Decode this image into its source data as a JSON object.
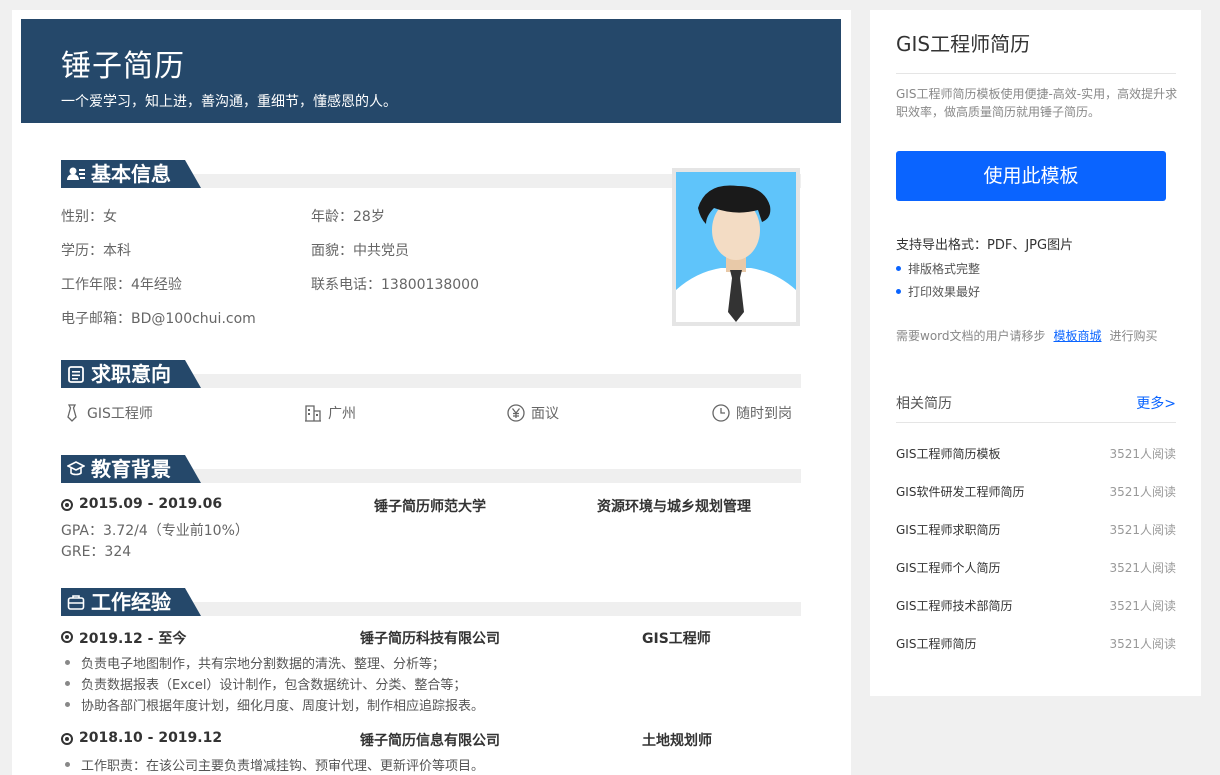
{
  "resume": {
    "name": "锤子简历",
    "motto": "一个爱学习，知上进，善沟通，重细节，懂感恩的人。",
    "sections": {
      "basic": "基本信息",
      "intent": "求职意向",
      "education": "教育背景",
      "work": "工作经验"
    },
    "basic_info": {
      "gender": "性别：女",
      "age": "年龄：28岁",
      "degree": "学历：本科",
      "politics": "面貌：中共党员",
      "years": "工作年限：4年经验",
      "phone": "联系电话：13800138000",
      "email": "电子邮箱：BD@100chui.com"
    },
    "intent": {
      "position": "GIS工程师",
      "city": "广州",
      "salary": "面议",
      "arrival": "随时到岗"
    },
    "education": {
      "period": "2015.09 - 2019.06",
      "school": "锤子简历师范大学",
      "major": "资源环境与城乡规划管理",
      "gpa": "GPA：3.72/4（专业前10%）",
      "gre": "GRE：324"
    },
    "work": [
      {
        "period": "2019.12 - 至今",
        "company": "锤子简历科技有限公司",
        "role": "GIS工程师",
        "bullets": [
          "负责电子地图制作，共有宗地分割数据的清洗、整理、分析等；",
          "负责数据报表（Excel）设计制作，包含数据统计、分类、整合等；",
          "协助各部门根据年度计划，细化月度、周度计划，制作相应追踪报表。"
        ]
      },
      {
        "period": "2018.10 - 2019.12",
        "company": "锤子简历信息有限公司",
        "role": "土地规划师",
        "bullets": [
          "工作职责：在该公司主要负责增减挂钩、预审代理、更新评价等项目。"
        ]
      }
    ]
  },
  "sidebar": {
    "title": "GIS工程师简历",
    "description": "GIS工程师简历模板使用便捷-高效-实用，高效提升求职效率，做高质量简历就用锤子简历。",
    "use_button": "使用此模板",
    "formats": "支持导出格式：PDF、JPG图片",
    "features": [
      "排版格式完整",
      "打印效果最好"
    ],
    "word_note_prefix": "需要word文档的用户请移步",
    "word_note_link": "模板商城",
    "word_note_suffix": "进行购买",
    "related_title": "相关简历",
    "related_more": "更多>",
    "related": [
      {
        "name": "GIS工程师简历模板",
        "count": "3521人阅读"
      },
      {
        "name": "GIS软件研发工程师简历",
        "count": "3521人阅读"
      },
      {
        "name": "GIS工程师求职简历",
        "count": "3521人阅读"
      },
      {
        "name": "GIS工程师个人简历",
        "count": "3521人阅读"
      },
      {
        "name": "GIS工程师技术部简历",
        "count": "3521人阅读"
      },
      {
        "name": "GIS工程师简历",
        "count": "3521人阅读"
      }
    ]
  },
  "colors": {
    "header": "#25486a",
    "accent": "#0a64ff",
    "photo_bg": "#5fc4fa"
  }
}
